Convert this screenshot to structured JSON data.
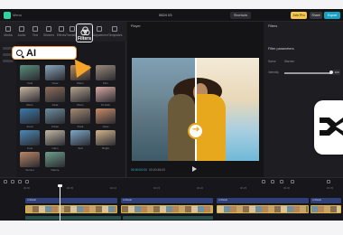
{
  "titlebar": {
    "menu": "Menu",
    "project_title": "0824 03",
    "shortcut_label": "Shortcuts",
    "join_pro": "Join Pro",
    "share": "Share",
    "export": "Export"
  },
  "tools": {
    "items": [
      {
        "label": "Media",
        "icon": "media-icon"
      },
      {
        "label": "Audio",
        "icon": "audio-icon"
      },
      {
        "label": "Text",
        "icon": "text-icon"
      },
      {
        "label": "Stickers",
        "icon": "stickers-icon"
      },
      {
        "label": "Effects",
        "icon": "effects-icon"
      },
      {
        "label": "Transitions",
        "icon": "transitions-icon"
      },
      {
        "label": "Filters",
        "icon": "filters-icon"
      },
      {
        "label": "Adjustment",
        "icon": "adjustment-icon"
      },
      {
        "label": "Templates",
        "icon": "templates-icon"
      }
    ]
  },
  "filters_callout": {
    "label": "Filters",
    "icon": "filters-icon"
  },
  "search": {
    "value": "AI",
    "icon": "search-icon"
  },
  "library": {
    "thumbs": [
      {
        "label": "Vivid",
        "color": "#5a8f7b"
      },
      {
        "label": "Clear",
        "color": "#8aa6bd"
      },
      {
        "label": "Warm",
        "color": "#b78a5c"
      },
      {
        "label": "Film",
        "color": "#9a8a7c"
      },
      {
        "label": "Retro",
        "color": "#c9b7a2"
      },
      {
        "label": "Fade",
        "color": "#8c6f5d"
      },
      {
        "label": "Mono",
        "color": "#b6a28e"
      },
      {
        "label": "Portrait",
        "color": "#d7a9a3"
      },
      {
        "label": "Food",
        "color": "#3c7aa8"
      },
      {
        "label": "Urban",
        "color": "#6e8e9d"
      },
      {
        "label": "Dusk",
        "color": "#a58a73"
      },
      {
        "label": "Glow",
        "color": "#c98d6a"
      },
      {
        "label": "Cool",
        "color": "#4d89b5"
      },
      {
        "label": "Calm",
        "color": "#c2b8a6"
      },
      {
        "label": "Soft",
        "color": "#7ea7c6"
      },
      {
        "label": "Bright",
        "color": "#d4b58e"
      },
      {
        "label": "Sunset",
        "color": "#b98766"
      },
      {
        "label": "Nature",
        "color": "#6e9f8b"
      }
    ]
  },
  "player": {
    "header": "Player",
    "timecode_current": "00:00:00:00",
    "timecode_total": "00:00:48:03"
  },
  "inspector": {
    "header": "Filters",
    "section": "Filter parameters",
    "row_name_label": "Name",
    "row_name_value": "Warmer",
    "row_intensity_label": "Intensity",
    "intensity_value": "100",
    "intensity_level": 1.0
  },
  "timeline": {
    "ruler": [
      "00:00",
      "00:05",
      "00:10",
      "00:15",
      "00:20",
      "00:25",
      "00:30",
      "00:35"
    ],
    "clip_bars": [
      {
        "label": "AI Retail"
      },
      {
        "label": "AI Retail"
      },
      {
        "label": "AI Retail"
      },
      {
        "label": "AI Retail"
      }
    ]
  },
  "colors": {
    "accent": "#17a2c3",
    "highlight": "#f0a24a",
    "clip_border": "#d9b43a"
  }
}
